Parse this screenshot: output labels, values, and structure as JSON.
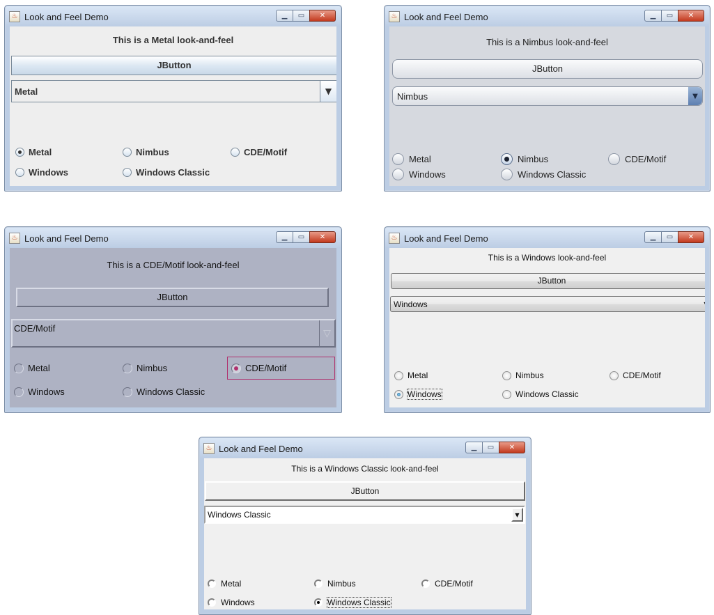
{
  "window_title": "Look and Feel Demo",
  "button_label": "JButton",
  "radio_labels": {
    "metal": "Metal",
    "nimbus": "Nimbus",
    "cde": "CDE/Motif",
    "windows": "Windows",
    "classic": "Windows Classic"
  },
  "window_controls": {
    "minimize": "minimize-icon",
    "maximize": "maximize-icon",
    "close": "close-icon",
    "app": "java-cup-icon"
  },
  "selected_states": {
    "metal": "Metal",
    "nimbus": "Nimbus",
    "motif": "CDE/Motif",
    "windows": "Windows",
    "classic": "Windows Classic"
  },
  "metal": {
    "caption": "This is a Metal look-and-feel",
    "combo_value": "Metal"
  },
  "nimbus": {
    "caption": "This is a Nimbus look-and-feel",
    "combo_value": "Nimbus"
  },
  "motif": {
    "caption": "This is a CDE/Motif look-and-feel",
    "combo_value": "CDE/Motif"
  },
  "windows": {
    "caption": "This is a Windows look-and-feel",
    "combo_value": "Windows"
  },
  "classic": {
    "caption": "This is a Windows Classic look-and-feel",
    "combo_value": "Windows Classic"
  }
}
